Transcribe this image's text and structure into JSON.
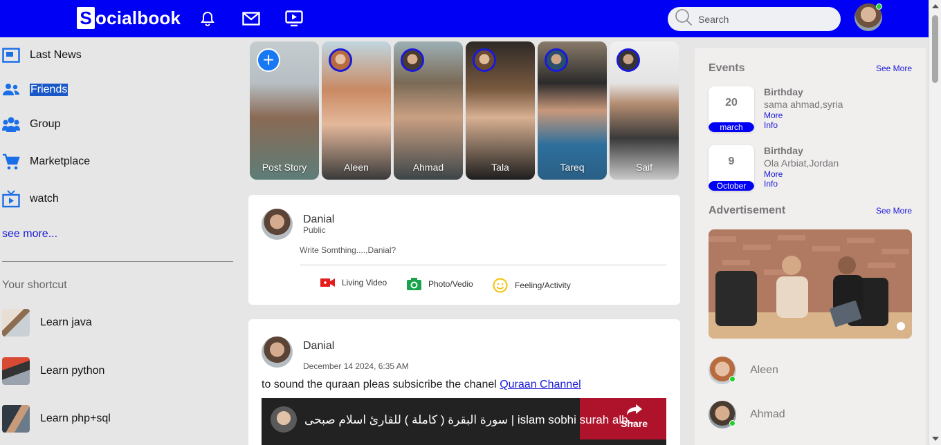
{
  "app": {
    "logo_letter": "S",
    "logo_text": "ocialbook",
    "brand_color": "#0000f5",
    "accent_link": "#1a1ad8",
    "online_color": "#1fd12e"
  },
  "header": {
    "icons": [
      "bell-icon",
      "mail-icon",
      "tv-play-icon"
    ],
    "search_placeholder": "Search"
  },
  "sidebar": {
    "items": [
      {
        "label": "Last News",
        "icon": "newspaper-icon"
      },
      {
        "label": "Friends",
        "icon": "friends-icon",
        "selected": true
      },
      {
        "label": "Group",
        "icon": "group-icon"
      },
      {
        "label": "Marketplace",
        "icon": "cart-icon"
      },
      {
        "label": "watch",
        "icon": "tv-icon"
      }
    ],
    "see_more": "see more...",
    "shortcut_title": "Your shortcut",
    "shortcuts": [
      {
        "label": "Learn java"
      },
      {
        "label": "Learn python"
      },
      {
        "label": "Learn php+sql"
      }
    ]
  },
  "stories": [
    {
      "name": "Post Story"
    },
    {
      "name": "Aleen"
    },
    {
      "name": "Ahmad"
    },
    {
      "name": "Tala"
    },
    {
      "name": "Tareq"
    },
    {
      "name": "Saif"
    }
  ],
  "composer": {
    "name": "Danial",
    "visibility": "Public",
    "placeholder": "Write Somthing....,Danial?",
    "actions": [
      {
        "label": "Living Video",
        "icon": "video-camera-icon",
        "color": "#e41e1e"
      },
      {
        "label": "Photo/Vedio",
        "icon": "camera-icon",
        "color": "#1aa34a"
      },
      {
        "label": "Feeling/Activity",
        "icon": "smile-icon",
        "color": "#f5c518"
      }
    ]
  },
  "post": {
    "name": "Danial",
    "date": "December 14 2024, 6:35 AM",
    "text": "to sound the quraan pleas subsicribe the chanel ",
    "link_text": "Quraan Channel",
    "video_title": "سورة البقرة ( كاملة ) للقارئ اسلام صبحى | islam sobhi surah alb...",
    "share_label": "Share"
  },
  "right": {
    "events_title": "Events",
    "events_link": "See More",
    "events": [
      {
        "day": "20",
        "month": "march",
        "title": "Birthday",
        "place": "sama ahmad,syria",
        "link": "More Info"
      },
      {
        "day": "9",
        "month": "October",
        "title": "Birthday",
        "place": "Ola Arbiat,Jordan",
        "link": "More Info"
      }
    ],
    "ad_title": "Advertisement",
    "ad_link": "See More",
    "contacts": [
      {
        "name": "Aleen"
      },
      {
        "name": "Ahmad"
      }
    ]
  }
}
